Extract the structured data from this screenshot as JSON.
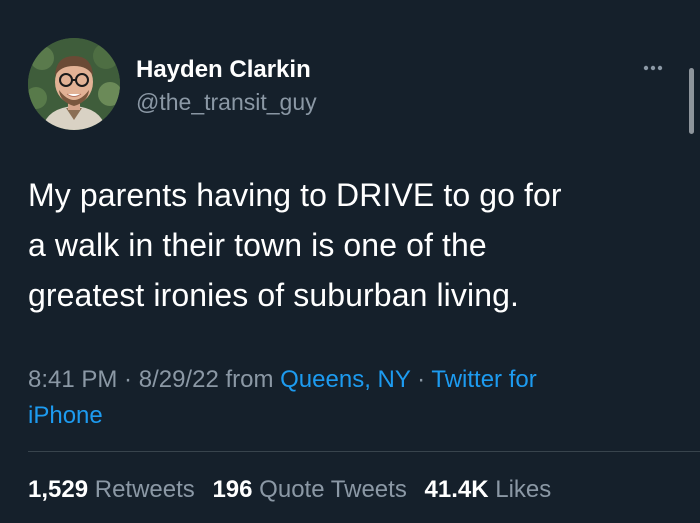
{
  "author": {
    "display_name": "Hayden Clarkin",
    "handle": "@the_transit_guy",
    "avatar_icon": "profile-photo"
  },
  "menu_icon": "more-dots-icon",
  "tweet": {
    "lines": [
      "My parents having to DRIVE to go for",
      "a walk in their town is one of the",
      "greatest ironies of suburban living."
    ]
  },
  "meta": {
    "time": "8:41 PM",
    "sep1": " · ",
    "date": "8/29/22",
    "from": " from ",
    "location": "Queens, NY",
    "sep2": " · ",
    "source_line1": "Twitter for",
    "source_line2": "iPhone"
  },
  "stats": {
    "retweets_count": "1,529",
    "retweets_label": "Retweets",
    "quotes_count": "196",
    "quotes_label": "Quote Tweets",
    "likes_count": "41.4K",
    "likes_label": "Likes"
  },
  "colors": {
    "background": "#15202b",
    "text": "#ffffff",
    "secondary": "#8b98a5",
    "link": "#1d9bf0",
    "divider": "#38444d"
  }
}
